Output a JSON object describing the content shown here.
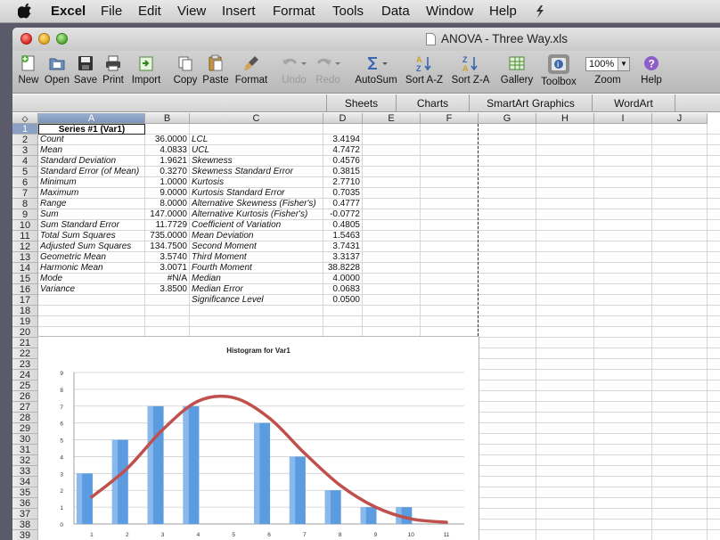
{
  "menubar": {
    "app": "Excel",
    "items": [
      "File",
      "Edit",
      "View",
      "Insert",
      "Format",
      "Tools",
      "Data",
      "Window",
      "Help"
    ]
  },
  "window": {
    "title": "ANOVA - Three Way.xls"
  },
  "toolbar": [
    {
      "label": "New",
      "icon": "new-icon",
      "enabled": true
    },
    {
      "label": "Open",
      "icon": "open-icon",
      "enabled": true
    },
    {
      "label": "Save",
      "icon": "save-icon",
      "enabled": true
    },
    {
      "label": "Print",
      "icon": "print-icon",
      "enabled": true
    },
    {
      "label": "Import",
      "icon": "import-icon",
      "enabled": true
    },
    {
      "label": "Copy",
      "icon": "copy-icon",
      "enabled": true
    },
    {
      "label": "Paste",
      "icon": "paste-icon",
      "enabled": true
    },
    {
      "label": "Format",
      "icon": "format-brush-icon",
      "enabled": true
    },
    {
      "label": "Undo",
      "icon": "undo-icon",
      "enabled": false
    },
    {
      "label": "Redo",
      "icon": "redo-icon",
      "enabled": false
    },
    {
      "label": "AutoSum",
      "icon": "autosum-icon",
      "enabled": true
    },
    {
      "label": "Sort A-Z",
      "icon": "sort-az-icon",
      "enabled": true
    },
    {
      "label": "Sort Z-A",
      "icon": "sort-za-icon",
      "enabled": true
    },
    {
      "label": "Gallery",
      "icon": "gallery-icon",
      "enabled": true
    },
    {
      "label": "Toolbox",
      "icon": "toolbox-icon",
      "enabled": true
    },
    {
      "label": "Zoom",
      "icon": "zoom-select",
      "enabled": true,
      "value": "100%"
    },
    {
      "label": "Help",
      "icon": "help-icon",
      "enabled": true
    }
  ],
  "ribbon_tabs": [
    "Sheets",
    "Charts",
    "SmartArt Graphics",
    "WordArt"
  ],
  "columns": [
    "A",
    "B",
    "C",
    "D",
    "E",
    "F",
    "G",
    "H",
    "I",
    "J"
  ],
  "selected_column": "A",
  "rows": [
    "1",
    "2",
    "3",
    "4",
    "5",
    "6",
    "7",
    "8",
    "9",
    "10",
    "11",
    "12",
    "13",
    "14",
    "15",
    "16",
    "17",
    "18",
    "19",
    "20",
    "21",
    "22",
    "23",
    "24",
    "25",
    "26",
    "27",
    "28",
    "29",
    "30",
    "31",
    "32",
    "33",
    "34",
    "35",
    "36",
    "37",
    "38",
    "39"
  ],
  "selected_row": "1",
  "header_cell": "Series #1 (Var1)",
  "stats": [
    {
      "a": "Count",
      "b": "36.0000",
      "c": "LCL",
      "d": "3.4194"
    },
    {
      "a": "Mean",
      "b": "4.0833",
      "c": "UCL",
      "d": "4.7472"
    },
    {
      "a": "Standard Deviation",
      "b": "1.9621",
      "c": "Skewness",
      "d": "0.4576"
    },
    {
      "a": "Standard Error (of Mean)",
      "b": "0.3270",
      "c": "Skewness Standard Error",
      "d": "0.3815"
    },
    {
      "a": "Minimum",
      "b": "1.0000",
      "c": "Kurtosis",
      "d": "2.7710"
    },
    {
      "a": "Maximum",
      "b": "9.0000",
      "c": "Kurtosis Standard Error",
      "d": "0.7035"
    },
    {
      "a": "Range",
      "b": "8.0000",
      "c": "Alternative Skewness (Fisher's)",
      "d": "0.4777"
    },
    {
      "a": "Sum",
      "b": "147.0000",
      "c": "Alternative Kurtosis (Fisher's)",
      "d": "-0.0772"
    },
    {
      "a": "Sum Standard Error",
      "b": "11.7729",
      "c": "Coefficient of Variation",
      "d": "0.4805"
    },
    {
      "a": "Total Sum Squares",
      "b": "735.0000",
      "c": "Mean Deviation",
      "d": "1.5463"
    },
    {
      "a": "Adjusted Sum Squares",
      "b": "134.7500",
      "c": "Second Moment",
      "d": "3.7431"
    },
    {
      "a": "Geometric Mean",
      "b": "3.5740",
      "c": "Third Moment",
      "d": "3.3137"
    },
    {
      "a": "Harmonic Mean",
      "b": "3.0071",
      "c": "Fourth Moment",
      "d": "38.8228"
    },
    {
      "a": "Mode",
      "b": "#N/A",
      "c": "Median",
      "d": "4.0000"
    },
    {
      "a": "Variance",
      "b": "3.8500",
      "c": "Median Error",
      "d": "0.0683"
    },
    {
      "a": "",
      "b": "",
      "c": "Significance Level",
      "d": "0.0500"
    }
  ],
  "chart_data": {
    "type": "bar",
    "title": "Histogram for Var1",
    "categories": [
      "1",
      "2",
      "3",
      "4",
      "5",
      "6",
      "7",
      "8",
      "9",
      "10",
      "11"
    ],
    "values": [
      3,
      5,
      7,
      7,
      0,
      6,
      4,
      2,
      1,
      1,
      0
    ],
    "ylim": [
      0,
      9
    ],
    "yticks": [
      "0",
      "1",
      "2",
      "3",
      "4",
      "5",
      "6",
      "7",
      "8",
      "9"
    ],
    "curve": [
      1.6,
      3.3,
      5.6,
      7.3,
      7.5,
      6.3,
      4.2,
      2.3,
      1.0,
      0.3,
      0.1
    ],
    "bar_color": "#5b9be0",
    "curve_color": "#c0504d",
    "grid": true
  }
}
